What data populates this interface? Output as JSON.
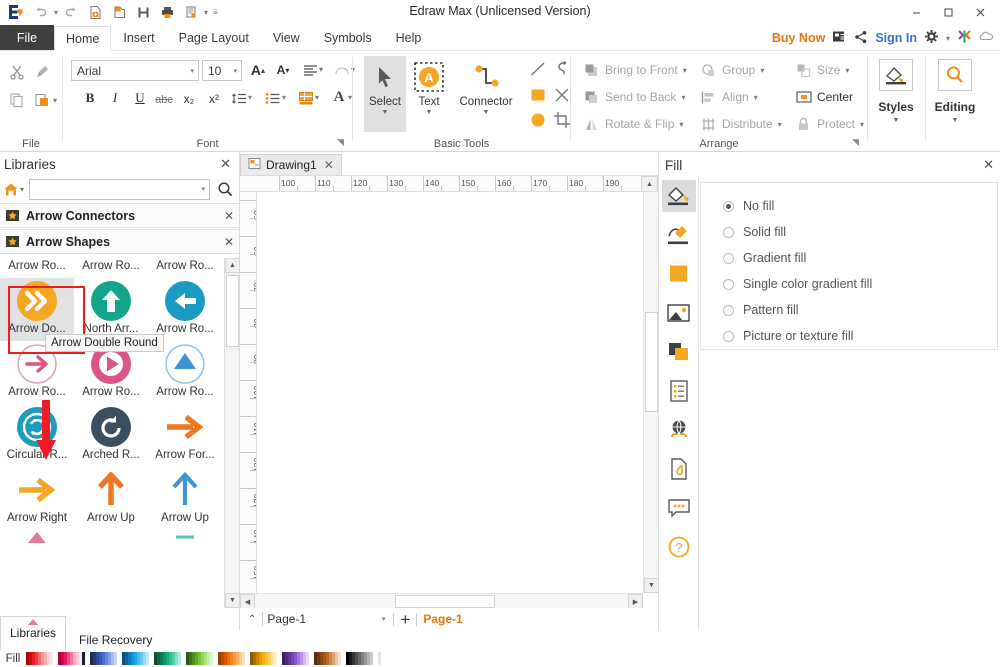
{
  "window": {
    "title": "Edraw Max (Unlicensed Version)",
    "minimize": "–",
    "maximize": "❐",
    "close": "✕"
  },
  "quick_access": [
    "logo",
    "undo-icon",
    "redo-icon",
    "new-icon",
    "open-icon",
    "save-icon",
    "print-icon",
    "export-icon",
    "qat-more-icon"
  ],
  "menu": {
    "file_tab": "File",
    "tabs": [
      "Home",
      "Insert",
      "Page Layout",
      "View",
      "Symbols",
      "Help"
    ],
    "active_tab": "Home",
    "buy_now": "Buy Now",
    "sign_in": "Sign In"
  },
  "ribbon": {
    "groups": [
      "File",
      "Font",
      "Basic Tools",
      "Arrange",
      "Styles",
      "Editing"
    ],
    "font": {
      "family": "Arial",
      "size": "10",
      "grow_label": "A",
      "shrink_label": "A",
      "bold": "B",
      "italic": "I",
      "underline": "U",
      "strike": "abc",
      "subscript": "x₂",
      "superscript": "x²"
    },
    "basic_tools": {
      "select": "Select",
      "text": "Text",
      "connector": "Connector",
      "text_glyph": "A"
    },
    "arrange": {
      "bring_to_front": "Bring to Front",
      "send_to_back": "Send to Back",
      "rotate_flip": "Rotate & Flip",
      "group": "Group",
      "align": "Align",
      "distribute": "Distribute",
      "size": "Size",
      "center": "Center",
      "protect": "Protect"
    },
    "styles_label": "Styles",
    "editing_label": "Editing"
  },
  "libraries": {
    "title": "Libraries",
    "search_value": "",
    "categories": [
      {
        "name": "Arrow Connectors"
      },
      {
        "name": "Arrow Shapes"
      }
    ],
    "shapes": [
      {
        "caption": "Arrow Ro...",
        "row": 0,
        "col": 0
      },
      {
        "caption": "Arrow Ro...",
        "row": 0,
        "col": 1
      },
      {
        "caption": "Arrow Ro...",
        "row": 0,
        "col": 2
      },
      {
        "caption": "Arrow Do...",
        "row": 1,
        "col": 0,
        "color": "#f6a623",
        "selected": true
      },
      {
        "caption": "North Arr...",
        "row": 1,
        "col": 1,
        "color": "#12a58c"
      },
      {
        "caption": "Arrow Ro...",
        "row": 1,
        "col": 2,
        "color": "#1b9ac4"
      },
      {
        "caption": "Arrow Ro...",
        "row": 2,
        "col": 0,
        "color": "#e3799f"
      },
      {
        "caption": "Arrow Ro...",
        "row": 2,
        "col": 1,
        "color": "#d9558b"
      },
      {
        "caption": "Arrow Ro...",
        "row": 2,
        "col": 2,
        "color": "#3d95d4"
      },
      {
        "caption": "Circular R...",
        "row": 3,
        "col": 0,
        "color": "#1d9cc0"
      },
      {
        "caption": "Arched R...",
        "row": 3,
        "col": 1,
        "color": "#3b4f63"
      },
      {
        "caption": "Arrow For...",
        "row": 3,
        "col": 2,
        "color": "#ef7622"
      },
      {
        "caption": "Arrow Right",
        "row": 4,
        "col": 0,
        "color": "#f5a623"
      },
      {
        "caption": "Arrow Up",
        "row": 4,
        "col": 1,
        "color": "#ef7622"
      },
      {
        "caption": "Arrow Up",
        "row": 4,
        "col": 2,
        "color": "#3d95d4"
      }
    ],
    "tooltip": "Arrow Double Round",
    "bottom_tabs": [
      {
        "label": "Libraries",
        "active": true
      },
      {
        "label": "File Recovery",
        "active": false
      }
    ]
  },
  "document": {
    "tab_name": "Drawing1",
    "hruler_ticks": [
      "100",
      "110",
      "120",
      "130",
      "140",
      "150",
      "160",
      "170",
      "180",
      "190"
    ],
    "vruler_ticks": [
      "50",
      "60",
      "70",
      "80",
      "90",
      "100",
      "110",
      "120",
      "130",
      "140",
      "150"
    ],
    "page_selector": "Page-1",
    "page_name": "Page-1",
    "add_page": "+"
  },
  "fill_panel": {
    "title": "Fill",
    "options": [
      {
        "label": "No fill",
        "selected": true
      },
      {
        "label": "Solid fill",
        "selected": false
      },
      {
        "label": "Gradient fill",
        "selected": false
      },
      {
        "label": "Single color gradient fill",
        "selected": false
      },
      {
        "label": "Pattern fill",
        "selected": false
      },
      {
        "label": "Picture or texture fill",
        "selected": false
      }
    ],
    "side_icons": [
      "fill-bucket-icon",
      "line-pen-icon",
      "shadow-square-icon",
      "picture-icon",
      "layer-icon",
      "list-doc-icon",
      "hyperlink-globe-icon",
      "attachment-doc-icon",
      "comment-icon",
      "help-icon"
    ]
  },
  "status": {
    "fill_label": "Fill",
    "palette": [
      "#b00000",
      "#c81010",
      "#e02020",
      "#ef3e3e",
      "#f26a6a",
      "#f59292",
      "#f7b5b5",
      "#fad4d4",
      "#fce8e8",
      "#b0003c",
      "#d0004a",
      "#e5195e",
      "#ef4a81",
      "#f47aa4",
      "#f8a6c2",
      "#fbcadd",
      "#fde4ee",
      "#151e3d",
      "#1d2b55",
      "#25386e",
      "#2f4790",
      "#3a59b4",
      "#4a6fd0",
      "#5f86de",
      "#7fa0e8",
      "#a6bcf0",
      "#c8d6f6",
      "#0b4f7a",
      "#0c6395",
      "#0d7ab5",
      "#1093d4",
      "#21a7e8",
      "#43b8ee",
      "#6ac9f2",
      "#95daf7",
      "#bfeafb",
      "#0c4f33",
      "#0e6341",
      "#107a52",
      "#139364",
      "#16ad77",
      "#2cc08c",
      "#55cfa5",
      "#85dfc0",
      "#b3ecd8",
      "#2e5b14",
      "#3c741a",
      "#4c8f21",
      "#5faa29",
      "#74c433",
      "#8fd453",
      "#ace379",
      "#c8eea5",
      "#e0f6cb",
      "#a03a00",
      "#bf4700",
      "#d95500",
      "#ee6a11",
      "#f5841f",
      "#f89a3c",
      "#fbb062",
      "#fdc98e",
      "#fee1bb",
      "#8b5a00",
      "#a96e00",
      "#c78400",
      "#e59a00",
      "#f7b10d",
      "#f9c13c",
      "#fbd16b",
      "#fde09b",
      "#fef0cd",
      "#3d1f63",
      "#4e2a7c",
      "#613796",
      "#7646b0",
      "#8c58c8",
      "#a376d6",
      "#bb95e2",
      "#d2b5ed",
      "#e8daf7",
      "#5a2d0c",
      "#6f3a10",
      "#874916",
      "#a05a1d",
      "#b96d28",
      "#c98948",
      "#d9a674",
      "#e8c3a3",
      "#f4e0d1",
      "#000000",
      "#1a1a1a",
      "#333333",
      "#4d4d4d",
      "#666666",
      "#808080",
      "#999999",
      "#b3b3b3",
      "#cccccc",
      "#e6e6e6"
    ]
  }
}
